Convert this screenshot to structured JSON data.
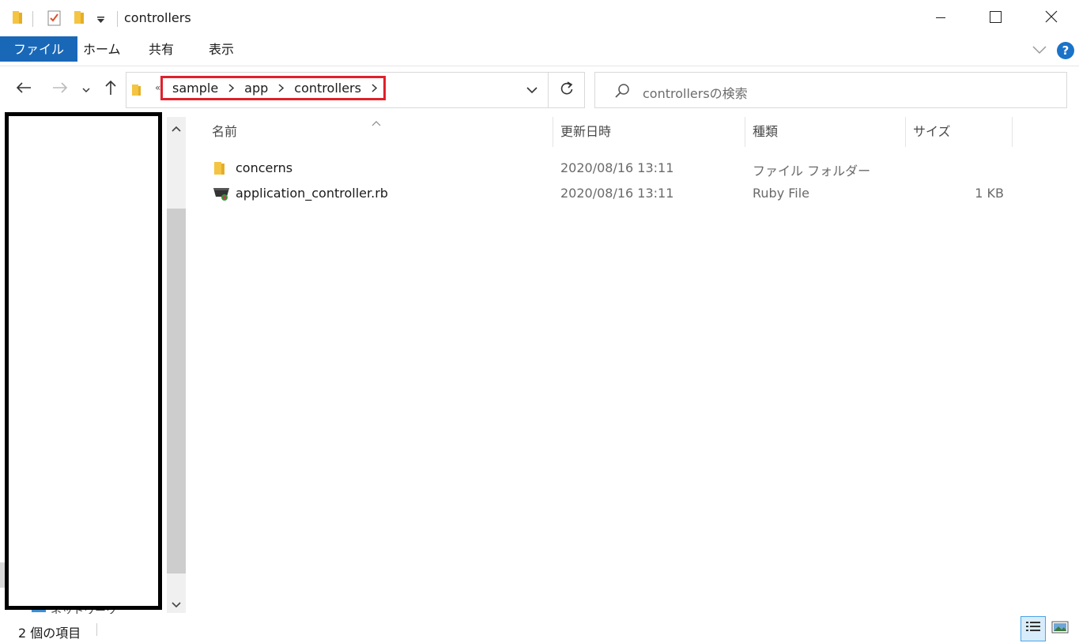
{
  "window": {
    "title": "controllers",
    "minimize_icon": "minimize-icon",
    "maximize_icon": "maximize-icon",
    "close_icon": "close-icon"
  },
  "quick_access": {
    "items": [
      "folder-icon",
      "properties-icon",
      "new-folder-icon",
      "customize-dropdown-icon"
    ]
  },
  "ribbon": {
    "tabs": [
      "ファイル",
      "ホーム",
      "共有",
      "表示"
    ],
    "help_label": "?"
  },
  "address": {
    "overflow": "«",
    "crumbs": [
      "sample",
      "app",
      "controllers"
    ]
  },
  "search": {
    "placeholder": "controllersの検索"
  },
  "columns": {
    "name": "名前",
    "date": "更新日時",
    "type": "種類",
    "size": "サイズ"
  },
  "files": [
    {
      "name": "concerns",
      "date": "2020/08/16 13:11",
      "type": "ファイル フォルダー",
      "size": "",
      "icon": "folder-icon"
    },
    {
      "name": "application_controller.rb",
      "date": "2020/08/16 13:11",
      "type": "Ruby File",
      "size": "1 KB",
      "icon": "ruby-file-icon"
    }
  ],
  "navpane": {
    "partial_label": "ネットワーク"
  },
  "status": {
    "item_count": "2 個の項目"
  },
  "colors": {
    "accent": "#1968b8",
    "highlight": "#e0202a",
    "folder": "#f4c542"
  }
}
